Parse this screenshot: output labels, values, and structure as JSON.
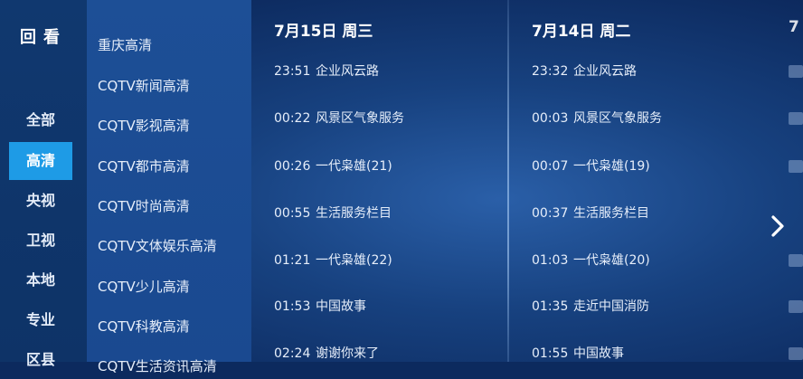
{
  "app": {
    "title": "回看"
  },
  "categories": [
    {
      "label": "全部"
    },
    {
      "label": "高清",
      "active": true
    },
    {
      "label": "央视"
    },
    {
      "label": "卫视"
    },
    {
      "label": "本地"
    },
    {
      "label": "专业"
    },
    {
      "label": "区县"
    }
  ],
  "channels": [
    {
      "label": "重庆高清"
    },
    {
      "label": "CQTV新闻高清"
    },
    {
      "label": "CQTV影视高清"
    },
    {
      "label": "CQTV都市高清"
    },
    {
      "label": "CQTV时尚高清"
    },
    {
      "label": "CQTV文体娱乐高清"
    },
    {
      "label": "CQTV少儿高清"
    },
    {
      "label": "CQTV科教高清"
    },
    {
      "label": "CQTV生活资讯高清"
    }
  ],
  "days": [
    {
      "header": "7月15日  周三",
      "programs": [
        {
          "time": "23:51",
          "title": "企业风云路"
        },
        {
          "time": "00:22",
          "title": "风景区气象服务"
        },
        {
          "time": "00:26",
          "title": "一代枭雄(21)"
        },
        {
          "time": "00:55",
          "title": "生活服务栏目"
        },
        {
          "time": "01:21",
          "title": "一代枭雄(22)"
        },
        {
          "time": "01:53",
          "title": "中国故事"
        },
        {
          "time": "02:24",
          "title": "谢谢你来了"
        }
      ]
    },
    {
      "header": "7月14日  周二",
      "programs": [
        {
          "time": "23:32",
          "title": "企业风云路"
        },
        {
          "time": "00:03",
          "title": "风景区气象服务"
        },
        {
          "time": "00:07",
          "title": "一代枭雄(19)"
        },
        {
          "time": "00:37",
          "title": "生活服务栏目"
        },
        {
          "time": "01:03",
          "title": "一代枭雄(20)"
        },
        {
          "time": "01:35",
          "title": "走近中国消防"
        },
        {
          "time": "01:55",
          "title": "中国故事"
        }
      ]
    }
  ],
  "peek_day": {
    "header": "7"
  },
  "icons": {
    "next": "chevron-right-icon"
  }
}
